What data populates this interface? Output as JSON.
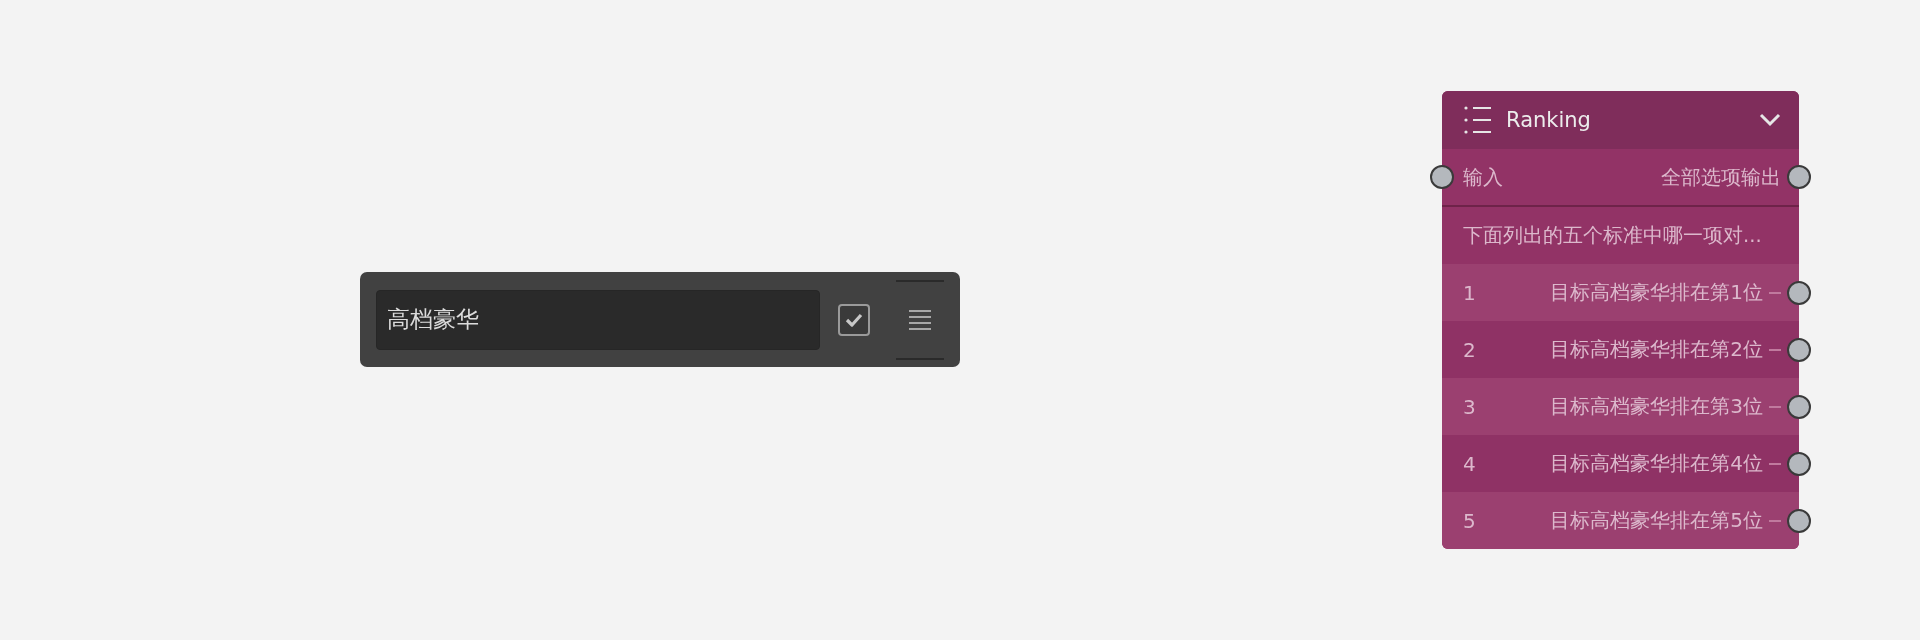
{
  "text_widget": {
    "value": "高档豪华",
    "checked": true
  },
  "ranking_node": {
    "title": "Ranking",
    "input_label": "输入",
    "output_label": "全部选项输出",
    "description": "下面列出的五个标准中哪一项对...",
    "rows": [
      {
        "number": "1",
        "label": "目标高档豪华排在第1位"
      },
      {
        "number": "2",
        "label": "目标高档豪华排在第2位"
      },
      {
        "number": "3",
        "label": "目标高档豪华排在第3位"
      },
      {
        "number": "4",
        "label": "目标高档豪华排在第4位"
      },
      {
        "number": "5",
        "label": "目标高档豪华排在第5位"
      }
    ]
  }
}
